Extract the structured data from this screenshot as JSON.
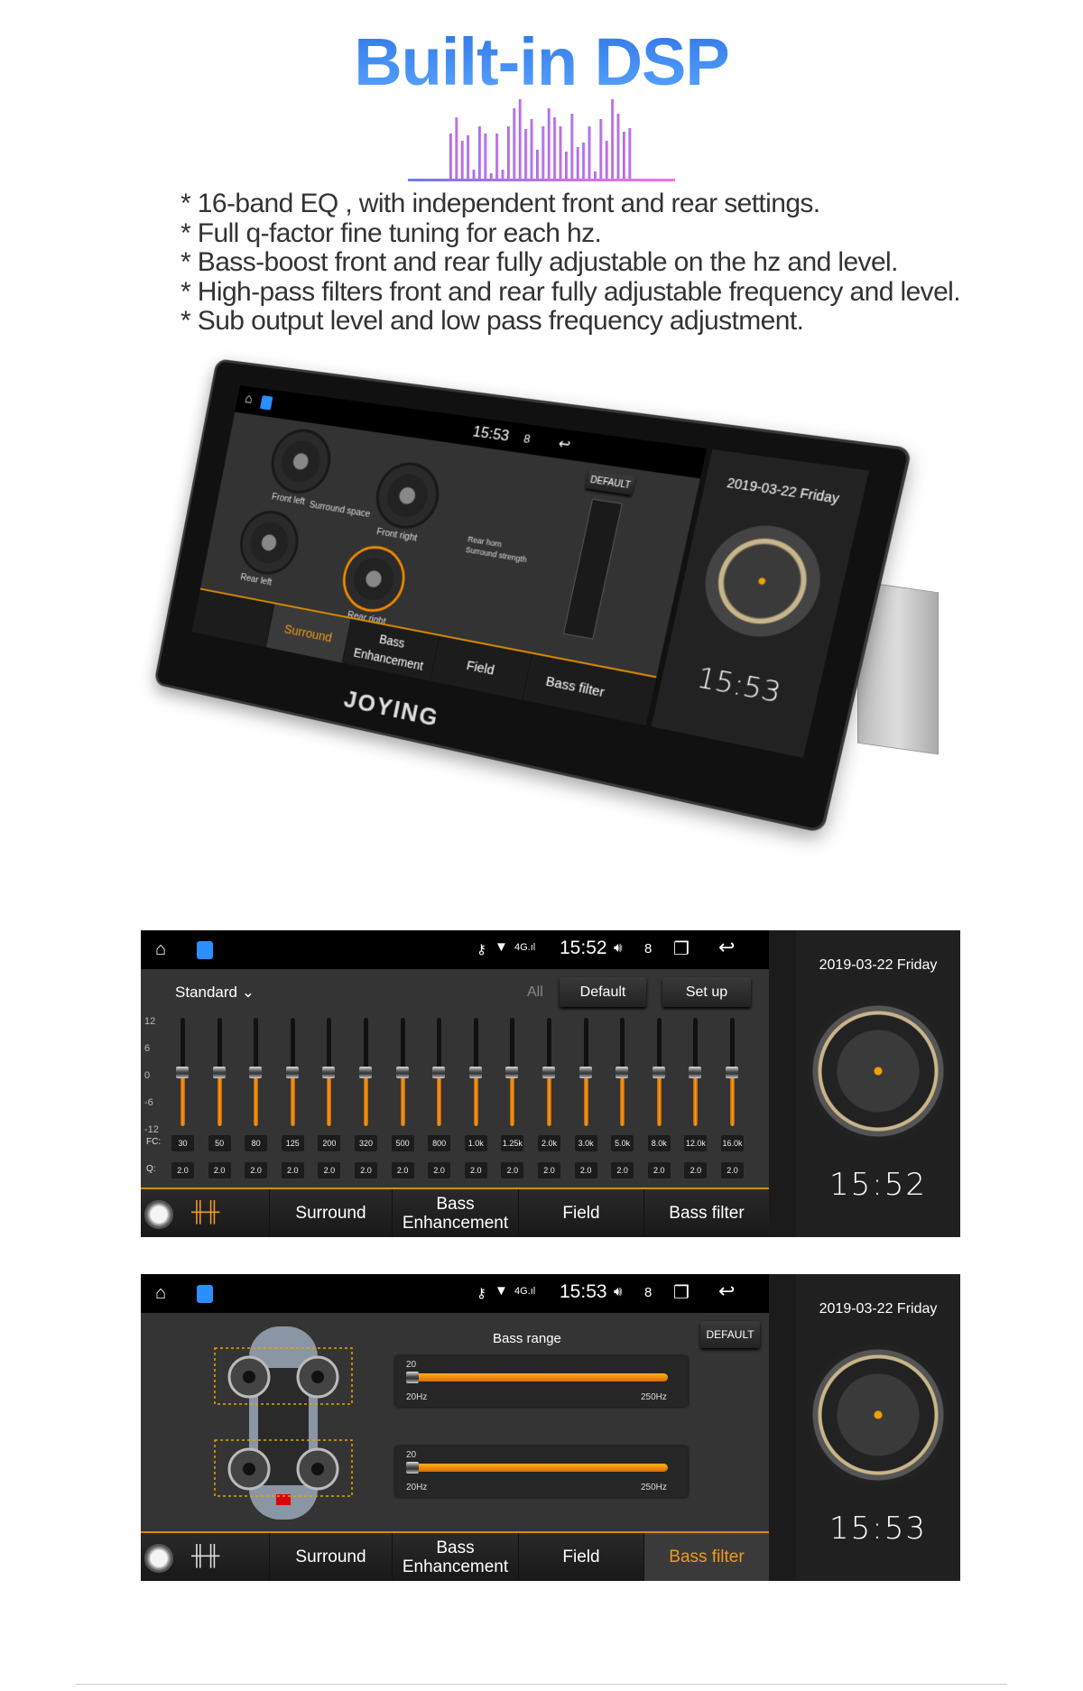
{
  "title": "Built-in DSP",
  "colors": {
    "title": "#3a86ec",
    "accent": "#f29a1c",
    "eq_logo_start": "#7b6cf0",
    "eq_logo_end": "#ff6ee0"
  },
  "features": [
    "* 16-band EQ , with independent front and rear settings.",
    "* Full q-factor fine tuning for each hz.",
    "* Bass-boost front and rear fully adjustable on the hz and level.",
    "* High-pass filters front and rear fully adjustable frequency and level.",
    "* Sub output level and  low pass frequency adjustment."
  ],
  "device": {
    "brand": "JOYING",
    "status_time": "15:53",
    "status_count": "8",
    "gauges": [
      "Front left",
      "Front right",
      "Rear left",
      "Rear right"
    ],
    "surround_space": "Surround space",
    "rear_horn": "Rear horn",
    "surround_strength": "Surround strength",
    "default_label": "DEFAULT",
    "tabs": [
      "Surround",
      "Bass Enhancement",
      "Field",
      "Bass filter"
    ],
    "active_tab": 0,
    "date": "2019-03-22 Friday",
    "clock_time": "15:53"
  },
  "eq_screen": {
    "status_time": "15:52",
    "status_count": "8",
    "preset": "Standard",
    "all_label": "All",
    "default_label": "Default",
    "setup_label": "Set up",
    "y_ticks": [
      "12",
      "6",
      "0",
      "-6",
      "-12"
    ],
    "fc_label": "FC:",
    "q_label": "Q:",
    "bands": [
      "30",
      "50",
      "80",
      "125",
      "200",
      "320",
      "500",
      "800",
      "1.0k",
      "1.25k",
      "2.0k",
      "3.0k",
      "5.0k",
      "8.0k",
      "12.0k",
      "16.0k"
    ],
    "q_values": [
      "2.0",
      "2.0",
      "2.0",
      "2.0",
      "2.0",
      "2.0",
      "2.0",
      "2.0",
      "2.0",
      "2.0",
      "2.0",
      "2.0",
      "2.0",
      "2.0",
      "2.0",
      "2.0"
    ],
    "gains_db": [
      0,
      0,
      0,
      0,
      0,
      0,
      0,
      0,
      0,
      0,
      0,
      0,
      0,
      0,
      0,
      0
    ],
    "tabs": [
      "Surround",
      "Bass Enhancement",
      "Field",
      "Bass filter"
    ],
    "active_tab": -1,
    "date": "2019-03-22 Friday",
    "clock_time": "15:52"
  },
  "bass_screen": {
    "status_time": "15:53",
    "status_count": "8",
    "bass_range_label": "Bass range",
    "default_label": "DEFAULT",
    "sliders": [
      {
        "value": "20",
        "min": "20Hz",
        "max": "250Hz"
      },
      {
        "value": "20",
        "min": "20Hz",
        "max": "250Hz"
      }
    ],
    "tabs": [
      "Surround",
      "Bass Enhancement",
      "Field",
      "Bass filter"
    ],
    "active_tab": 3,
    "date": "2019-03-22 Friday",
    "clock_time": "15:53"
  }
}
